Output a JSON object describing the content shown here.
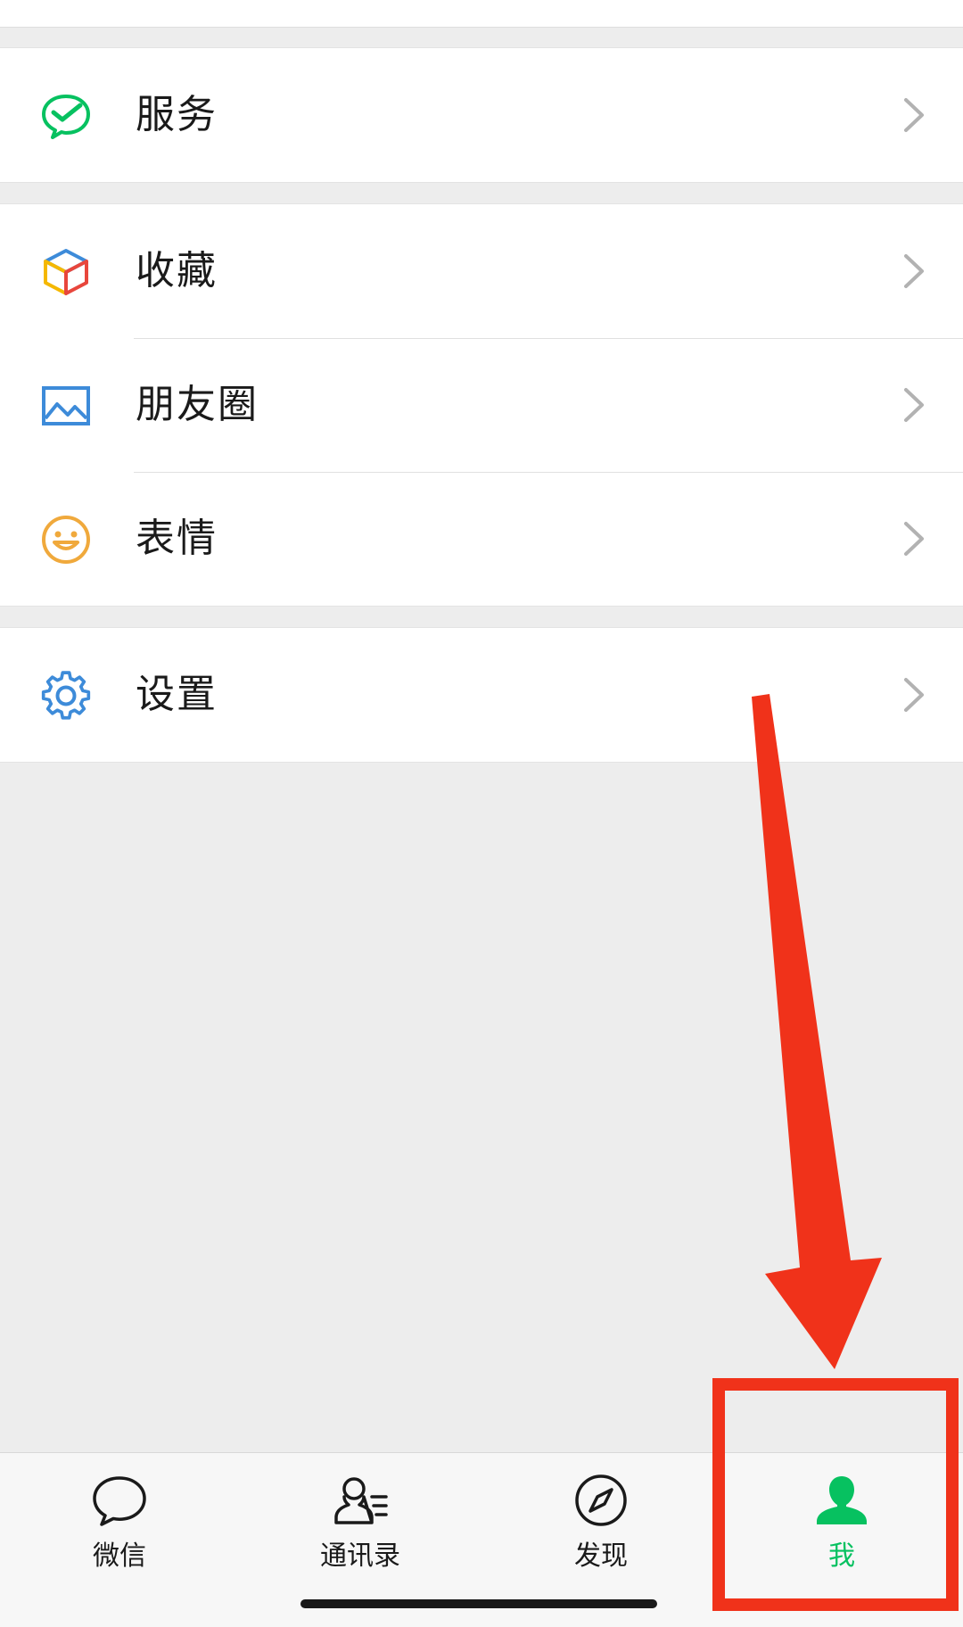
{
  "menu": {
    "services": {
      "label": "服务",
      "icon": "wechat-pay-icon"
    },
    "favorites": {
      "label": "收藏",
      "icon": "cube-icon"
    },
    "moments": {
      "label": "朋友圈",
      "icon": "picture-icon"
    },
    "stickers": {
      "label": "表情",
      "icon": "smiley-icon"
    },
    "settings": {
      "label": "设置",
      "icon": "gear-icon"
    }
  },
  "tabbar": {
    "chats": {
      "label": "微信",
      "icon": "chat-bubble-icon"
    },
    "contacts": {
      "label": "通讯录",
      "icon": "contacts-icon"
    },
    "discover": {
      "label": "发现",
      "icon": "compass-icon"
    },
    "me": {
      "label": "我",
      "icon": "person-icon",
      "selected": true
    }
  },
  "annotation": {
    "color": "#f0321a",
    "target": "me tab"
  },
  "colors": {
    "accent": "#07c160",
    "background": "#ededed"
  }
}
